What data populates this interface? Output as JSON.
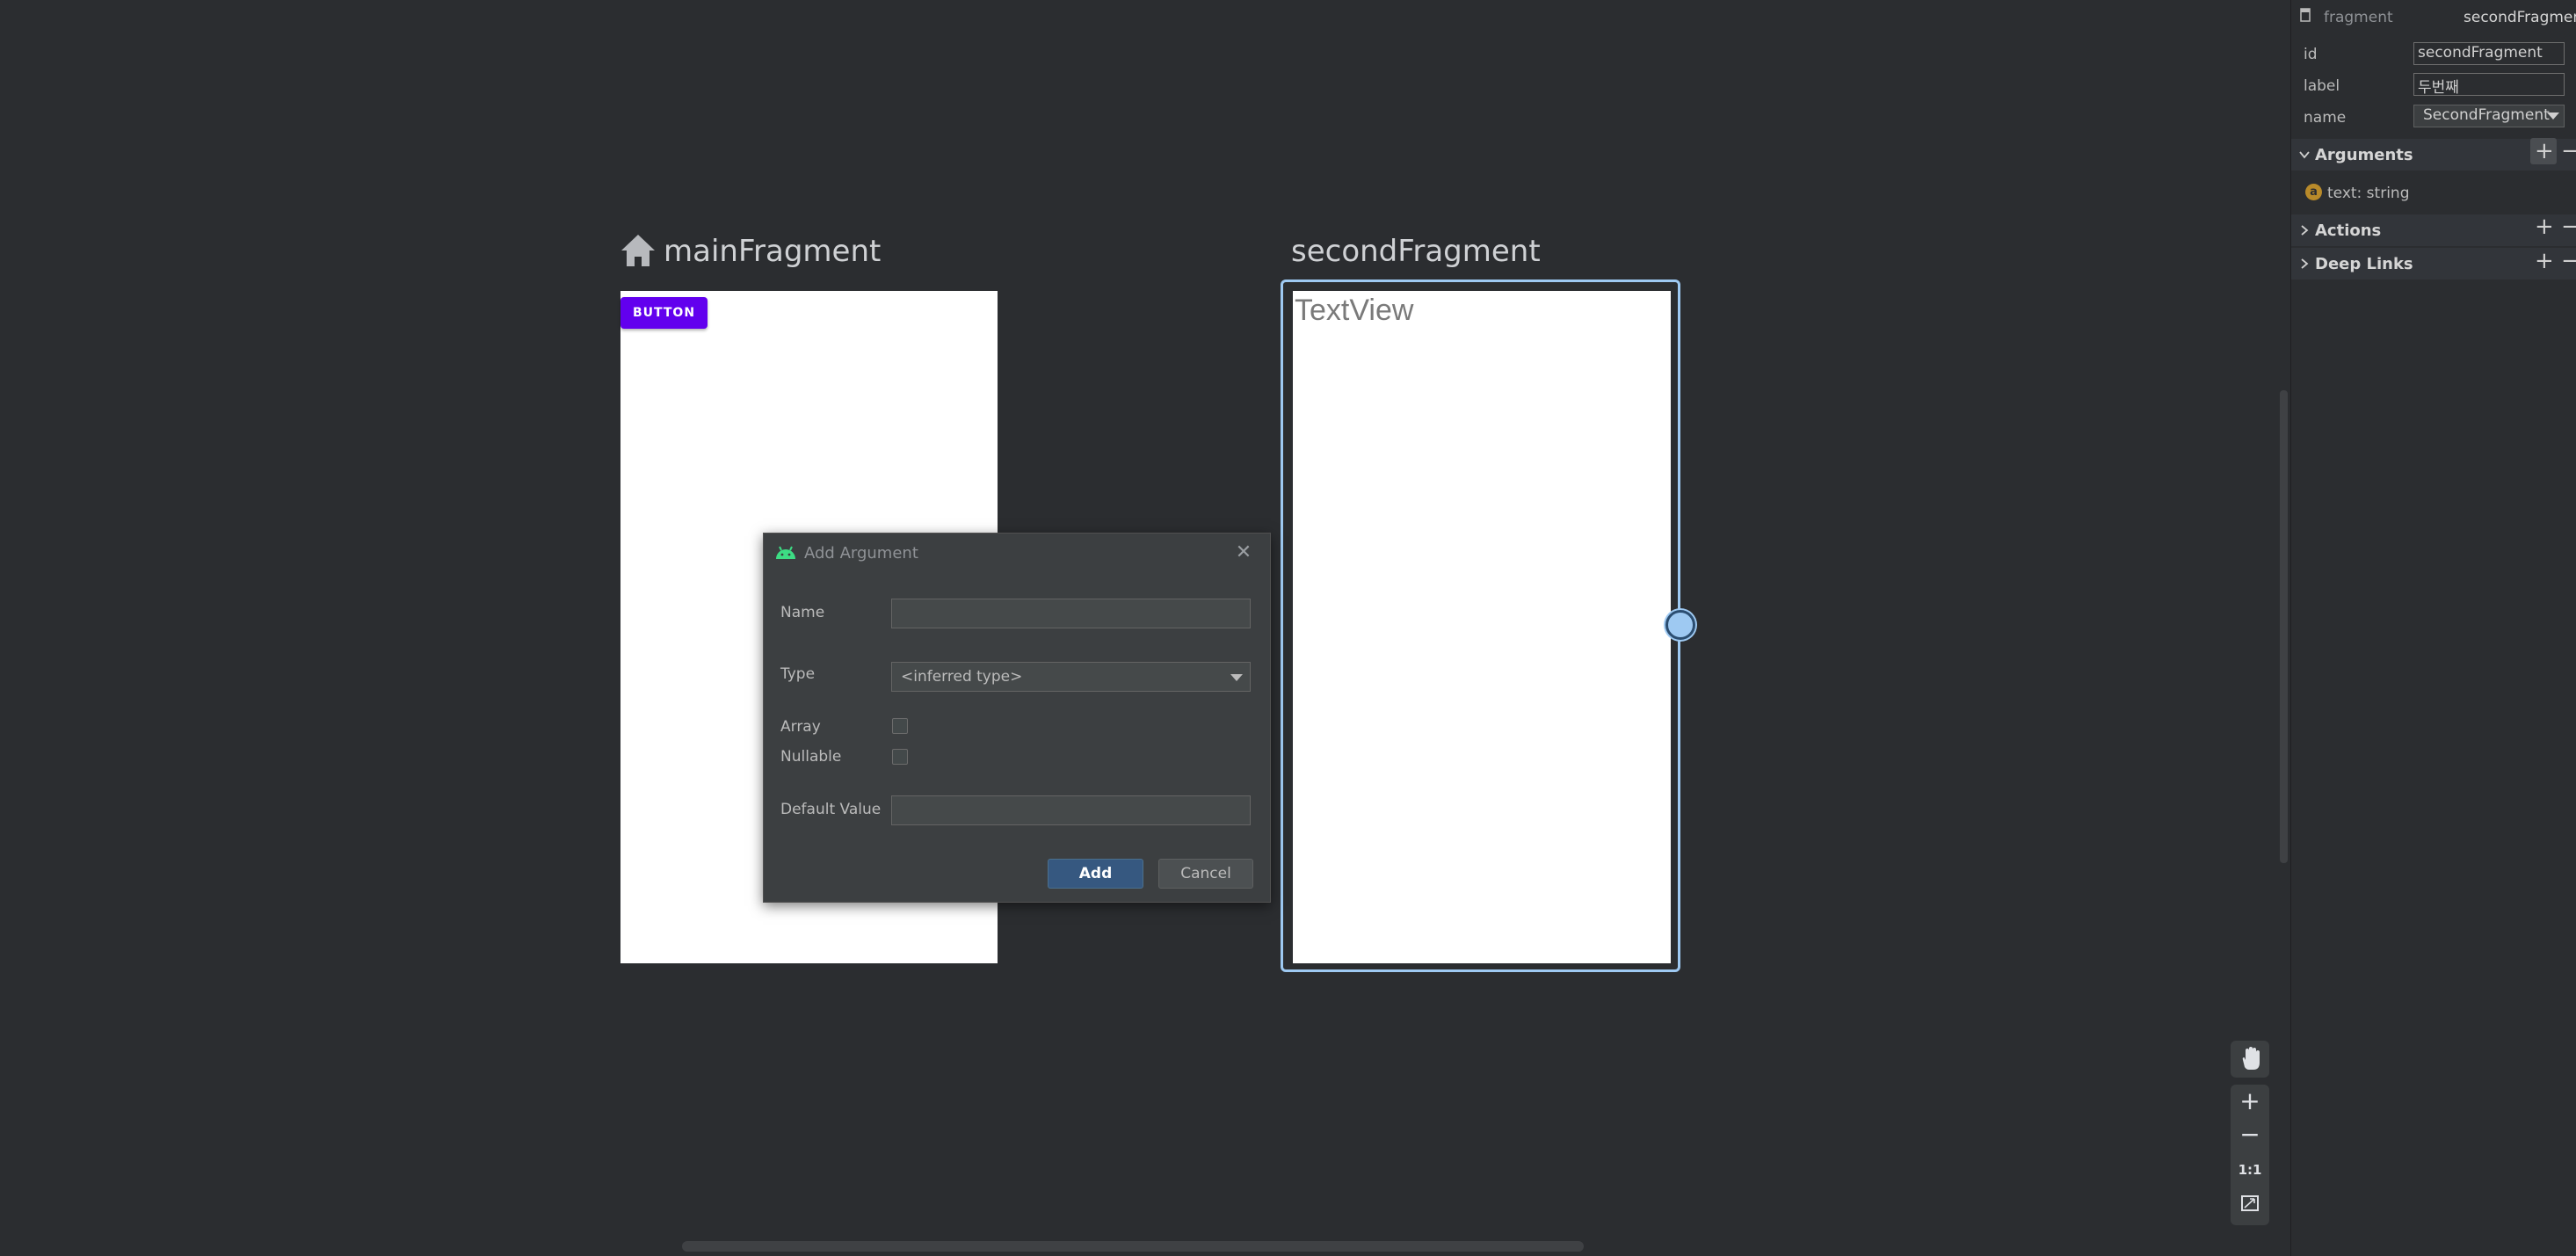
{
  "canvas": {
    "main_fragment": {
      "title": "mainFragment",
      "button_label": "BUTTON"
    },
    "second_fragment": {
      "title": "secondFragment",
      "textview": "TextView"
    }
  },
  "dialog": {
    "title": "Add Argument",
    "close": "✕",
    "name_label": "Name",
    "name_value": "",
    "type_label": "Type",
    "type_value": "<inferred type>",
    "array_label": "Array",
    "nullable_label": "Nullable",
    "default_label": "Default Value",
    "default_value": "",
    "add_label": "Add",
    "cancel_label": "Cancel"
  },
  "zoom": {
    "zoom_in": "+",
    "zoom_out": "−",
    "actual_size": "1:1"
  },
  "attributes": {
    "kind": "fragment",
    "header_id": "secondFragment",
    "id_label": "id",
    "id_value": "secondFragment",
    "label_label": "label",
    "label_value": "두번째",
    "name_label": "name",
    "name_value": "SecondFragment",
    "sections": {
      "arguments": "Arguments",
      "actions": "Actions",
      "deep_links": "Deep Links"
    },
    "argument_items": [
      {
        "badge": "a",
        "text": "text: string"
      }
    ],
    "plus": "+",
    "minus": "−"
  },
  "colors": {
    "canvas_bg": "#2b2d30",
    "button_purple": "#6200ee",
    "selection_blue": "#9ec9f2",
    "primary_button": "#365880"
  }
}
